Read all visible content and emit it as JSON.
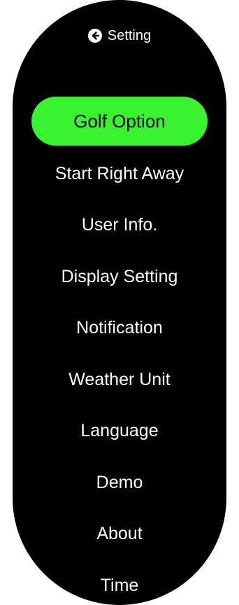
{
  "header": {
    "title": "Setting",
    "back_icon": "arrow-left-circle-icon"
  },
  "colors": {
    "screen_bg": "#000000",
    "accent": "#38f22f",
    "text": "#ffffff"
  },
  "menu": {
    "selected_index": 0,
    "items": [
      {
        "label": "Golf Option"
      },
      {
        "label": "Start Right Away"
      },
      {
        "label": "User Info."
      },
      {
        "label": "Display Setting"
      },
      {
        "label": "Notification"
      },
      {
        "label": "Weather Unit"
      },
      {
        "label": "Language"
      },
      {
        "label": "Demo"
      },
      {
        "label": "About"
      },
      {
        "label": "Time"
      }
    ]
  }
}
